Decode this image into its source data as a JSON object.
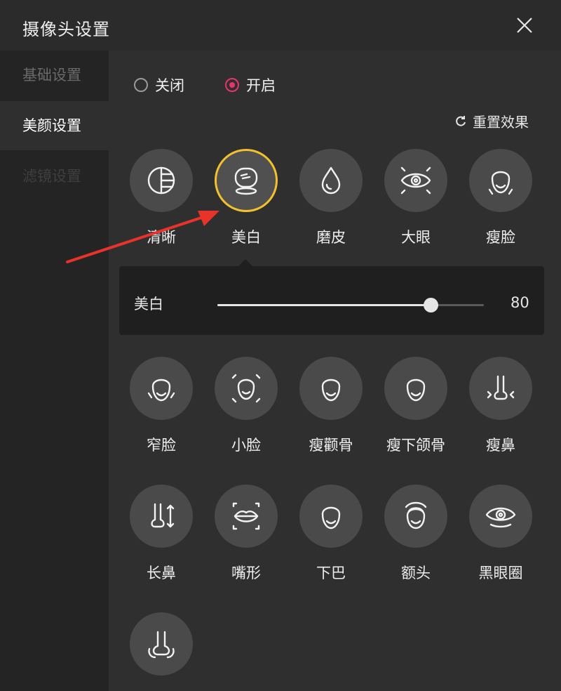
{
  "window": {
    "title": "摄像头设置"
  },
  "sidebar": {
    "items": [
      {
        "label": "基础设置"
      },
      {
        "label": "美颜设置"
      },
      {
        "label": "滤镜设置"
      }
    ]
  },
  "beauty": {
    "toggle": {
      "off_label": "关闭",
      "on_label": "开启",
      "selected": "开启"
    },
    "reset_label": "重置效果",
    "effects": [
      {
        "label": "清晰",
        "icon": "clarity-icon"
      },
      {
        "label": "美白",
        "icon": "whitening-icon",
        "selected": true
      },
      {
        "label": "磨皮",
        "icon": "smooth-skin-icon"
      },
      {
        "label": "大眼",
        "icon": "big-eye-icon"
      },
      {
        "label": "瘦脸",
        "icon": "slim-face-icon"
      },
      {
        "label": "窄脸",
        "icon": "narrow-face-icon"
      },
      {
        "label": "小脸",
        "icon": "small-face-icon"
      },
      {
        "label": "瘦颧骨",
        "icon": "cheekbone-icon"
      },
      {
        "label": "瘦下颌骨",
        "icon": "jawbone-icon"
      },
      {
        "label": "瘦鼻",
        "icon": "slim-nose-icon"
      },
      {
        "label": "长鼻",
        "icon": "long-nose-icon"
      },
      {
        "label": "嘴形",
        "icon": "mouth-shape-icon"
      },
      {
        "label": "下巴",
        "icon": "chin-icon"
      },
      {
        "label": "额头",
        "icon": "forehead-icon"
      },
      {
        "label": "黑眼圈",
        "icon": "dark-circles-icon"
      },
      {
        "label": "",
        "icon": "nose-wing-icon"
      }
    ],
    "slider": {
      "label": "美白",
      "value": 80,
      "max": 100
    }
  },
  "colors": {
    "accent_radio": "#e8336b",
    "selected_ring": "#f2c12e",
    "annotation_arrow": "#e8332a"
  }
}
